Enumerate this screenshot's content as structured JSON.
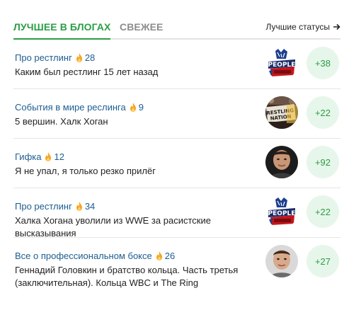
{
  "tabs": {
    "active_label": "ЛУЧШЕЕ В БЛОГАХ",
    "inactive_label": "СВЕЖЕЕ",
    "best_statuses_label": "Лучшие статусы"
  },
  "colors": {
    "accent": "#2a9d47",
    "link": "#1d5d90",
    "fire": "#f5a623",
    "score_bg": "#e7f6ea"
  },
  "items": [
    {
      "blog": "Про рестлинг",
      "count": "28",
      "title": "Каким был рестлинг 15 лет назад",
      "score": "+38",
      "avatar": "people-power-logo"
    },
    {
      "blog": "События в мире реслинга",
      "count": "9",
      "title": "5 вершин. Халк Хоган",
      "score": "+22",
      "avatar": "wrestling-sign-photo"
    },
    {
      "blog": "Гифка",
      "count": "12",
      "title": "Я не упал, я только резко прилёг",
      "score": "+92",
      "avatar": "boxer-portrait"
    },
    {
      "blog": "Про рестлинг",
      "count": "34",
      "title": "Халка Хогана уволили из WWE за расистские высказывания",
      "score": "+22",
      "avatar": "people-power-logo"
    },
    {
      "blog": "Все о профессиональном боксе",
      "count": "26",
      "title": "Геннадий Головкин и братство кольца. Часть третья (заключительная). Кольца WBC и The Ring",
      "score": "+27",
      "avatar": "boxer-portrait"
    }
  ]
}
